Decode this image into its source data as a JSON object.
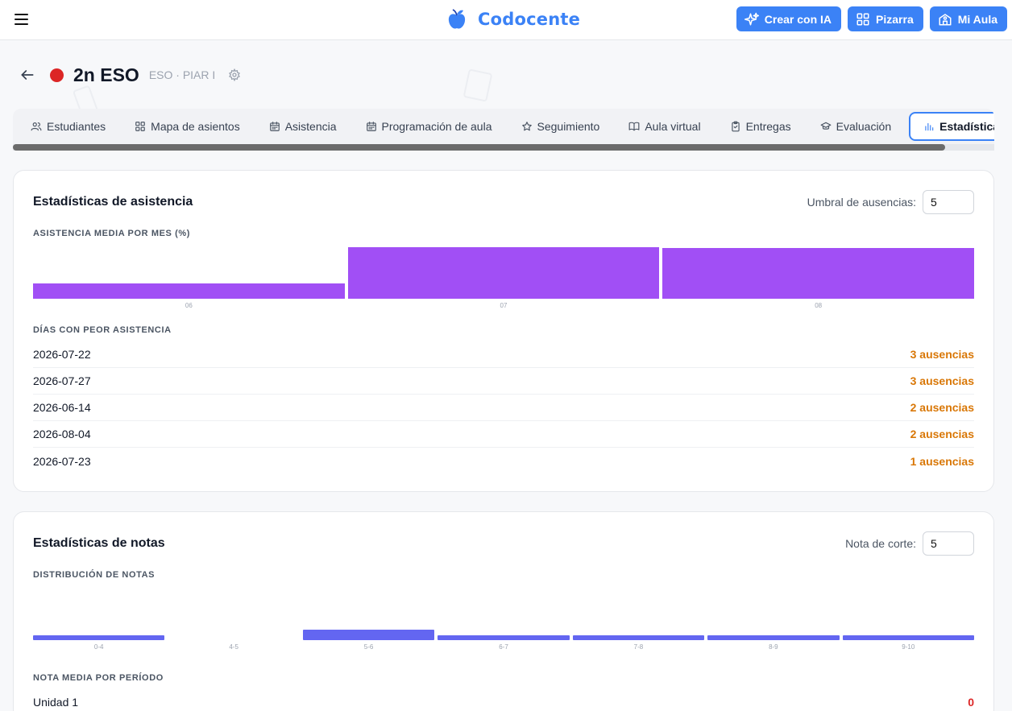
{
  "brand": {
    "name": "Codocente"
  },
  "topbar": {
    "buttons": [
      {
        "label": "Crear con IA",
        "icon": "sparkles-icon"
      },
      {
        "label": "Pizarra",
        "icon": "grid-icon"
      },
      {
        "label": "Mi Aula",
        "icon": "school-icon"
      }
    ]
  },
  "class_header": {
    "title": "2n ESO",
    "subtitle": "ESO · PIAR I",
    "status_color": "#dc2626"
  },
  "tabs": [
    {
      "label": "Estudiantes",
      "icon": "users-icon"
    },
    {
      "label": "Mapa de asientos",
      "icon": "grid-icon"
    },
    {
      "label": "Asistencia",
      "icon": "calendar-icon"
    },
    {
      "label": "Programación de aula",
      "icon": "calendar-icon"
    },
    {
      "label": "Seguimiento",
      "icon": "star-icon"
    },
    {
      "label": "Aula virtual",
      "icon": "book-icon"
    },
    {
      "label": "Entregas",
      "icon": "clipboard-check-icon"
    },
    {
      "label": "Evaluación",
      "icon": "graduation-cap-icon"
    },
    {
      "label": "Estadísticas",
      "icon": "bar-chart-icon",
      "active": true
    }
  ],
  "attendance": {
    "title": "Estadísticas de asistencia",
    "threshold_label": "Umbral de ausencias:",
    "threshold_value": "5",
    "chart_label": "ASISTENCIA MEDIA POR MES (%)",
    "worst_days_label": "DÍAS CON PEOR ASISTENCIA",
    "worst_days": [
      {
        "date": "2026-07-22",
        "count": "3 ausencias"
      },
      {
        "date": "2026-07-27",
        "count": "3 ausencias"
      },
      {
        "date": "2026-06-14",
        "count": "2 ausencias"
      },
      {
        "date": "2026-08-04",
        "count": "2 ausencias"
      },
      {
        "date": "2026-07-23",
        "count": "1 ausencias"
      }
    ]
  },
  "grades": {
    "title": "Estadísticas de notas",
    "cutoff_label": "Nota de corte:",
    "cutoff_value": "5",
    "chart_label": "DISTRIBUCIÓN DE NOTAS",
    "period_label": "NOTA MEDIA POR PERÍODO",
    "periods": [
      {
        "name": "Unidad 1",
        "value": "0"
      }
    ]
  },
  "chart_data": [
    {
      "type": "bar",
      "title": "ASISTENCIA MEDIA POR MES (%)",
      "categories": [
        "06",
        "07",
        "08"
      ],
      "values": [
        29,
        100,
        98
      ],
      "ylim": [
        0,
        100
      ],
      "color": "#a14ff5",
      "grid": false
    },
    {
      "type": "bar",
      "title": "DISTRIBUCIÓN DE NOTAS",
      "categories": [
        "0-4",
        "4-5",
        "5-6",
        "6-7",
        "7-8",
        "8-9",
        "9-10"
      ],
      "values": [
        1,
        0,
        2,
        1,
        1,
        1,
        1
      ],
      "ylim": [
        0,
        10
      ],
      "color": "#6366f1",
      "grid": false
    }
  ]
}
